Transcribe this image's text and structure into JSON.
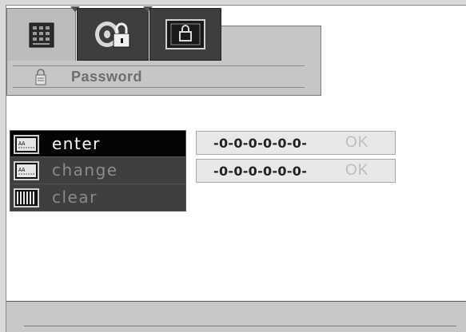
{
  "tabs": [
    {
      "name": "keypad-tab",
      "icon": "keypad-icon",
      "active": true
    },
    {
      "name": "film-lock-tab",
      "icon": "film-lock-icon",
      "active": false
    },
    {
      "name": "screen-lock-tab",
      "icon": "screen-lock-icon",
      "active": false
    }
  ],
  "header": {
    "title": "Password",
    "icon": "lock-icon"
  },
  "menu": [
    {
      "label": "enter",
      "icon": "code-entry-icon",
      "selected": true
    },
    {
      "label": "change",
      "icon": "code-entry-icon",
      "selected": false
    },
    {
      "label": "clear",
      "icon": "barcode-icon",
      "selected": false
    }
  ],
  "code_rows": [
    {
      "code": "-0-0-0-0-0-0-",
      "ok_label": "OK"
    },
    {
      "code": "-0-0-0-0-0-0-",
      "ok_label": "OK"
    }
  ],
  "colors": {
    "active_bg": "#050505",
    "item_bg": "#3f3f3f",
    "panel": "#c6c6c6"
  }
}
